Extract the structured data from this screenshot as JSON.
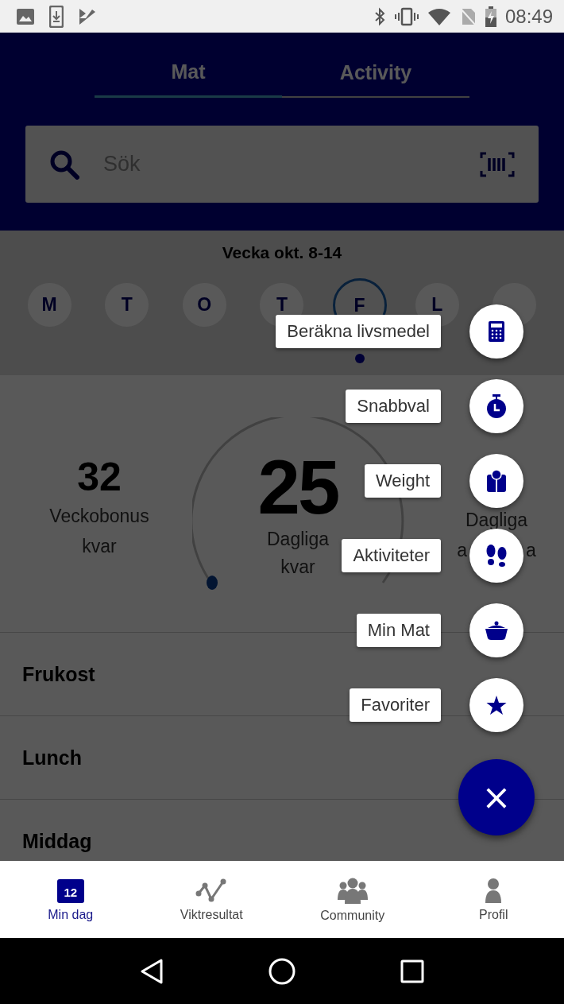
{
  "status_bar": {
    "time": "08:49"
  },
  "tabs": [
    {
      "label": "Mat",
      "selected": true
    },
    {
      "label": "Activity",
      "selected": false
    }
  ],
  "search": {
    "placeholder": "Sök"
  },
  "week": {
    "title": "Vecka okt. 8-14",
    "days": [
      {
        "letter": "M",
        "selected": false
      },
      {
        "letter": "T",
        "selected": false
      },
      {
        "letter": "O",
        "selected": false
      },
      {
        "letter": "T",
        "selected": false
      },
      {
        "letter": "F",
        "selected": true
      },
      {
        "letter": "L",
        "selected": false
      },
      {
        "selected": false
      }
    ]
  },
  "stats": {
    "weekly": {
      "value": "32",
      "line1": "Veckobonus",
      "line2": "kvar"
    },
    "daily": {
      "value": "25",
      "line1": "Dagliga",
      "line2": "kvar"
    },
    "right": {
      "line1": "Dagliga",
      "line2_start": "a",
      "line2_end": "a"
    }
  },
  "meals": [
    "Frukost",
    "Lunch",
    "Middag"
  ],
  "speed_dial": {
    "open": true,
    "close_symbol": "×",
    "items": [
      {
        "label": "Beräkna livsmedel"
      },
      {
        "label": "Snabbval"
      },
      {
        "label": "Weight"
      },
      {
        "label": "Aktiviteter"
      },
      {
        "label": "Min Mat"
      },
      {
        "label": "Favoriter"
      }
    ]
  },
  "bottom_nav": [
    {
      "label": "Min dag",
      "selected": true,
      "icon_text": "12"
    },
    {
      "label": "Viktresultat",
      "selected": false
    },
    {
      "label": "Community",
      "selected": false
    },
    {
      "label": "Profil",
      "selected": false
    }
  ]
}
